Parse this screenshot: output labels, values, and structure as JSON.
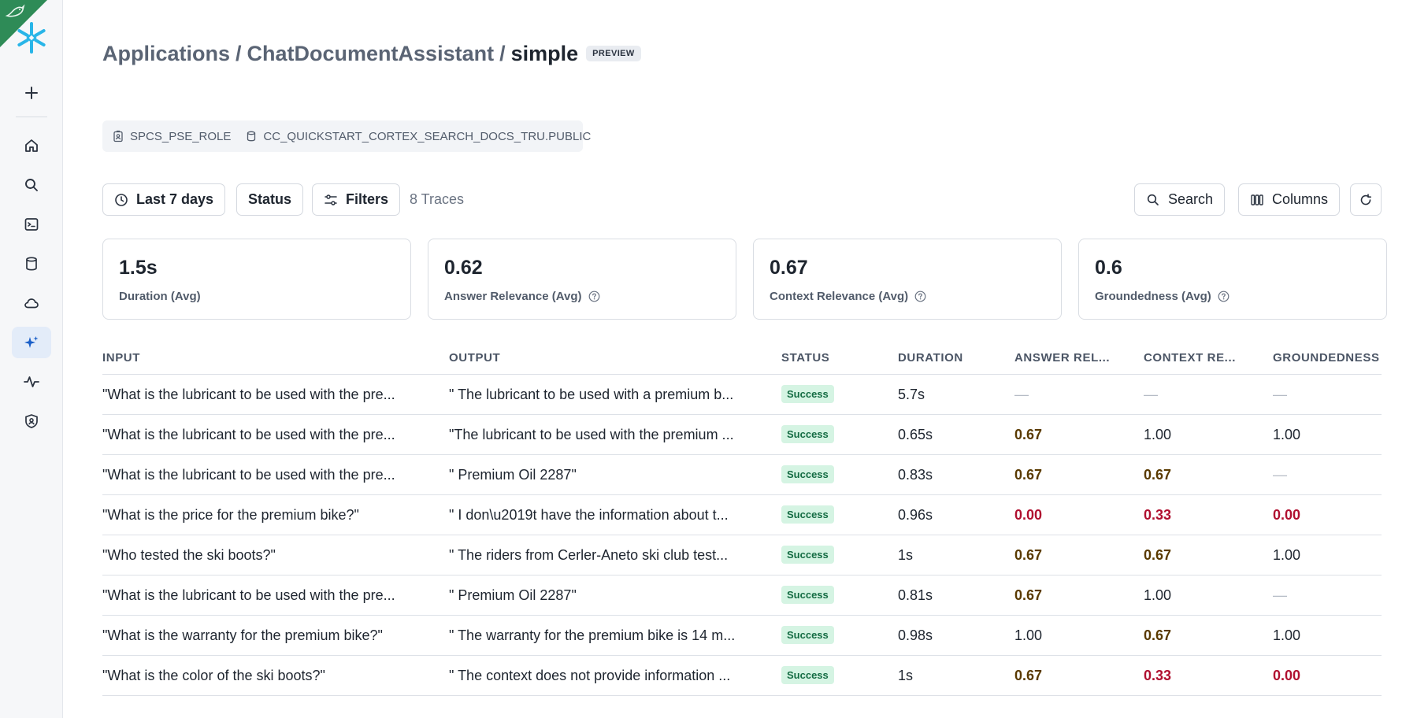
{
  "breadcrumb": {
    "root": "Applications",
    "app": "ChatDocumentAssistant",
    "version": "simple",
    "badge": "PREVIEW"
  },
  "context": {
    "role": "SPCS_PSE_ROLE",
    "schema": "CC_QUICKSTART_CORTEX_SEARCH_DOCS_TRU.PUBLIC"
  },
  "toolbar": {
    "time_range": "Last 7 days",
    "status": "Status",
    "filters": "Filters",
    "trace_count": "8 Traces",
    "search": "Search",
    "columns": "Columns"
  },
  "metrics": [
    {
      "value": "1.5s",
      "label": "Duration (Avg)",
      "help": false
    },
    {
      "value": "0.62",
      "label": "Answer Relevance (Avg)",
      "help": true
    },
    {
      "value": "0.67",
      "label": "Context Relevance (Avg)",
      "help": true
    },
    {
      "value": "0.6",
      "label": "Groundedness (Avg)",
      "help": true
    }
  ],
  "table": {
    "columns": [
      "INPUT",
      "OUTPUT",
      "STATUS",
      "DURATION",
      "ANSWER REL...",
      "CONTEXT RE...",
      "GROUNDEDNESS"
    ],
    "rows": [
      {
        "input": "\"What is the lubricant to be used with the pre...",
        "output": "\" The lubricant to be used with a premium b...",
        "status": "Success",
        "duration": "5.7s",
        "answer": "—",
        "context": "—",
        "grounded": "—"
      },
      {
        "input": "\"What is the lubricant to be used with the pre...",
        "output": "\"The lubricant to be used with the premium ...",
        "status": "Success",
        "duration": "0.65s",
        "answer": "0.67",
        "context": "1.00",
        "grounded": "1.00"
      },
      {
        "input": "\"What is the lubricant to be used with the pre...",
        "output": "\" Premium Oil 2287\"",
        "status": "Success",
        "duration": "0.83s",
        "answer": "0.67",
        "context": "0.67",
        "grounded": "—"
      },
      {
        "input": "\"What is the price for the premium bike?\"",
        "output": "\" I don\\u2019t have the information about t...",
        "status": "Success",
        "duration": "0.96s",
        "answer": "0.00",
        "context": "0.33",
        "grounded": "0.00"
      },
      {
        "input": "\"Who tested the ski boots?\"",
        "output": "\" The riders from Cerler-Aneto ski club test...",
        "status": "Success",
        "duration": "1s",
        "answer": "0.67",
        "context": "0.67",
        "grounded": "1.00"
      },
      {
        "input": "\"What is the lubricant to be used with the pre...",
        "output": "\" Premium Oil 2287\"",
        "status": "Success",
        "duration": "0.81s",
        "answer": "0.67",
        "context": "1.00",
        "grounded": "—"
      },
      {
        "input": "\"What is the warranty for the premium bike?\"",
        "output": "\" The warranty for the premium bike is 14 m...",
        "status": "Success",
        "duration": "0.98s",
        "answer": "1.00",
        "context": "0.67",
        "grounded": "1.00"
      },
      {
        "input": "\"What is the color of the ski boots?\"",
        "output": "\" The context does not provide information ...",
        "status": "Success",
        "duration": "1s",
        "answer": "0.67",
        "context": "0.33",
        "grounded": "0.00"
      }
    ]
  },
  "colors": {
    "score_mid": "#5a3a00",
    "score_low": "#b01030",
    "success_bg": "#d5f4e3",
    "accent": "#29b5e8"
  }
}
